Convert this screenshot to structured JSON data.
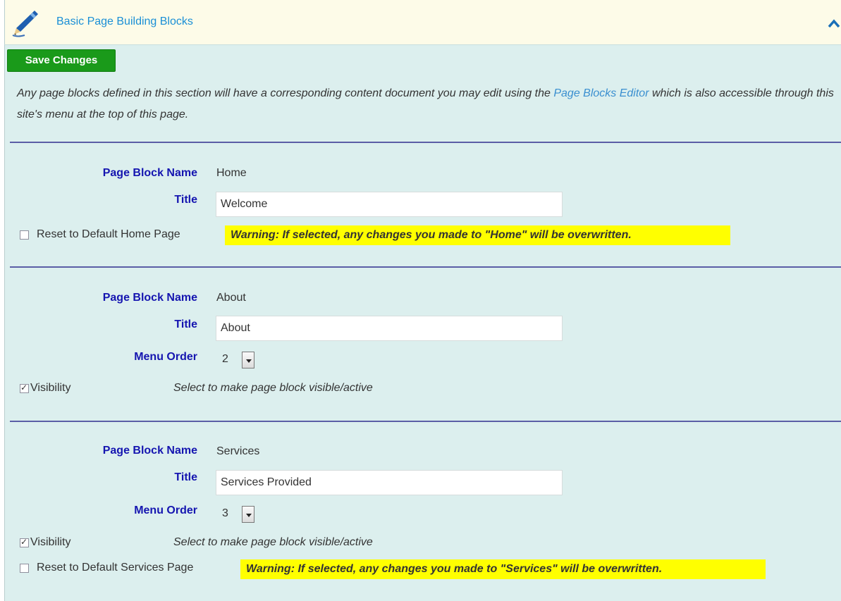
{
  "header": {
    "title": "Basic Page Building Blocks",
    "icon": "pencil-icon",
    "collapse_icon": "chevron-up-icon"
  },
  "toolbar": {
    "save_label": "Save Changes"
  },
  "intro": {
    "text_before": "Any page blocks defined in this section will have a corresponding content document you may edit using the ",
    "link": "Page Blocks Editor",
    "text_after": " which is also accessible through this site's menu at the top of this page."
  },
  "labels": {
    "block_name": "Page Block Name",
    "title": "Title",
    "menu_order": "Menu Order",
    "visibility": "Visibility",
    "visibility_hint": "Select to make page block visible/active"
  },
  "blocks": [
    {
      "name": "Home",
      "title_value": "Welcome",
      "reset_label": "Reset to Default Home Page",
      "reset_checked": false,
      "warning": "Warning: If selected, any changes you made to \"Home\" will be overwritten."
    },
    {
      "name": "About",
      "title_value": "About",
      "menu_order": "2",
      "visible": true
    },
    {
      "name": "Services",
      "title_value": "Services Provided",
      "menu_order": "3",
      "visible": true,
      "reset_label": "Reset to Default Services Page",
      "reset_checked": false,
      "warning": "Warning: If selected, any changes you made to \"Services\" will be overwritten."
    }
  ],
  "colors": {
    "panel_bg": "#dcefee",
    "header_bg": "#fdfbe8",
    "label_blue": "#1515b0",
    "link_blue": "#1a8fd6",
    "save_green": "#1a9a1a",
    "warning_yellow": "#ffff00",
    "rule": "#5b5ea6"
  }
}
